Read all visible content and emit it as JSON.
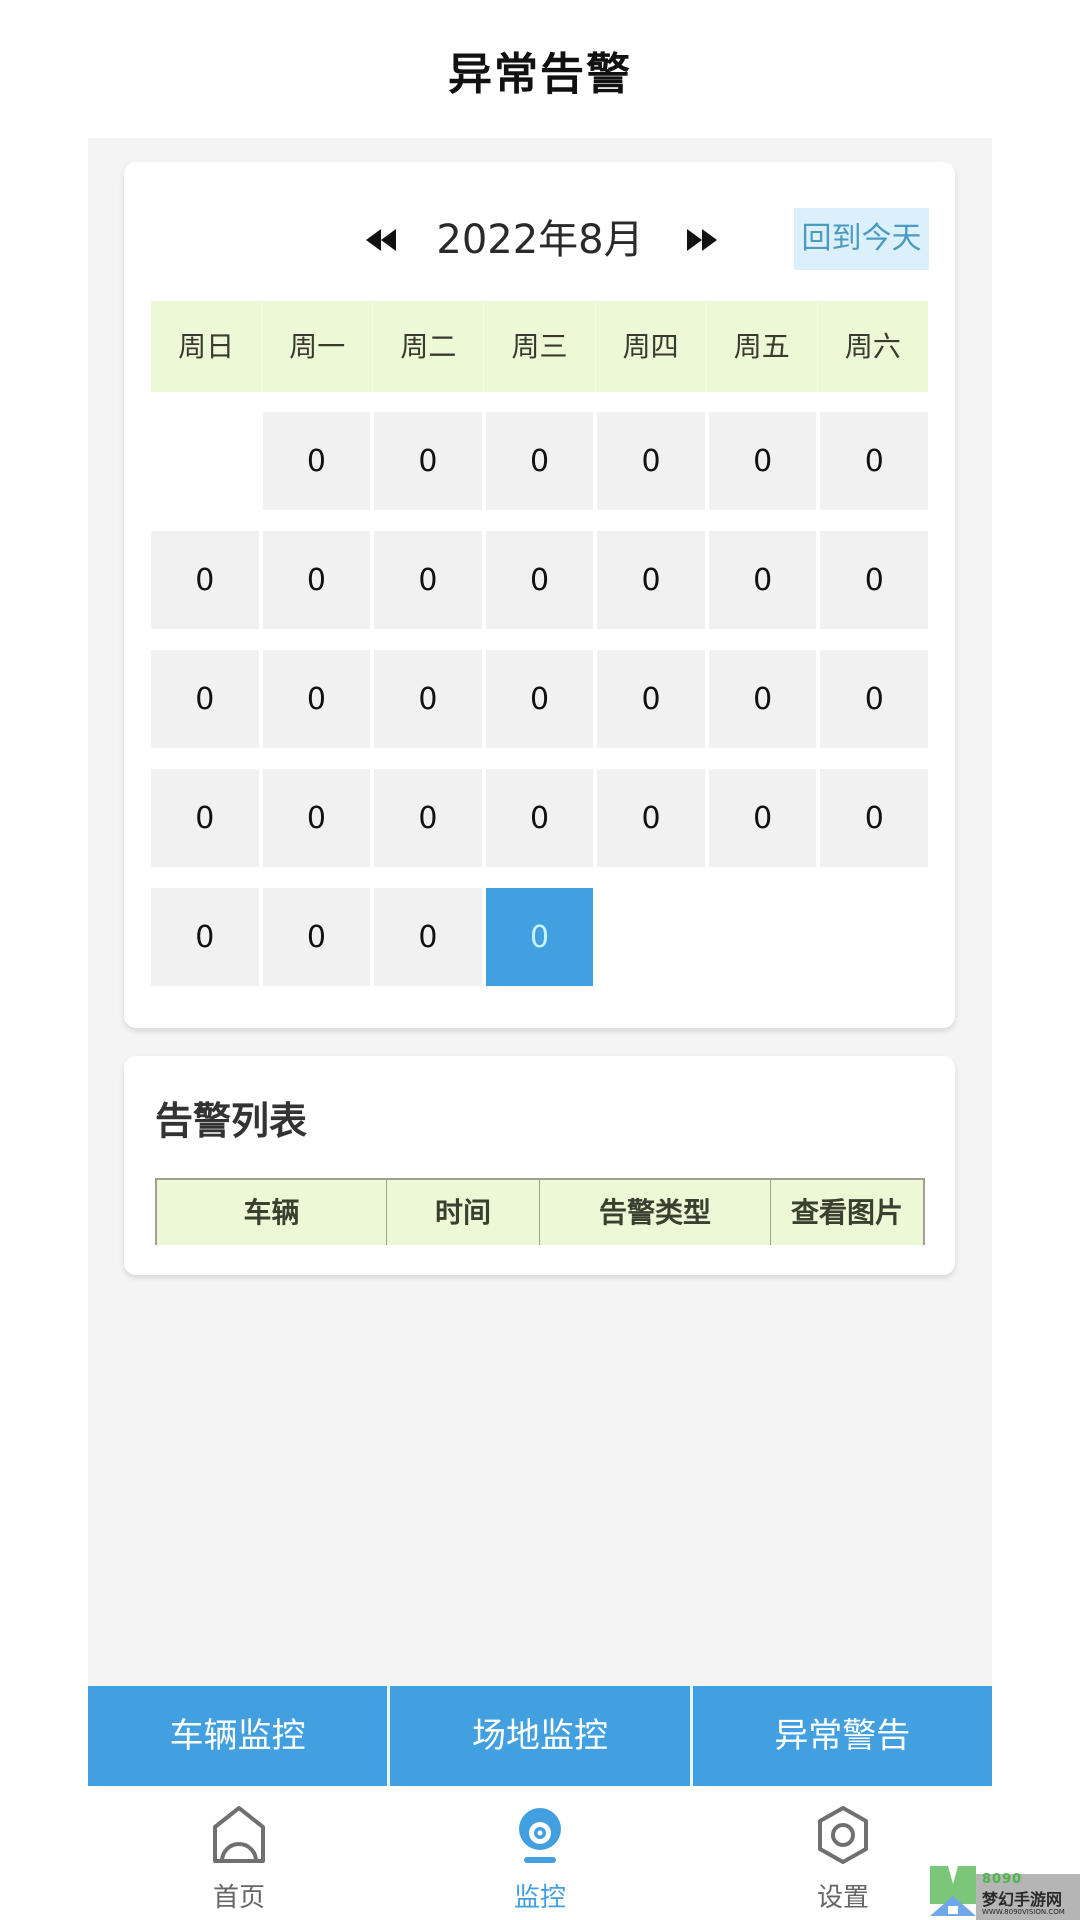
{
  "header": {
    "title": "异常告警"
  },
  "calendar": {
    "month_label": "2022年8月",
    "prev_icon": "double-triangle-left",
    "next_icon": "double-triangle-right",
    "today_button": "回到今天",
    "weekdays": [
      "周日",
      "周一",
      "周二",
      "周三",
      "周四",
      "周五",
      "周六"
    ],
    "weeks": [
      [
        "",
        "0",
        "0",
        "0",
        "0",
        "0",
        "0"
      ],
      [
        "0",
        "0",
        "0",
        "0",
        "0",
        "0",
        "0"
      ],
      [
        "0",
        "0",
        "0",
        "0",
        "0",
        "0",
        "0"
      ],
      [
        "0",
        "0",
        "0",
        "0",
        "0",
        "0",
        "0"
      ],
      [
        "0",
        "0",
        "0",
        "0",
        "",
        "",
        ""
      ]
    ],
    "selected": {
      "week": 4,
      "day": 3
    },
    "colors": {
      "header_bg": "#ecf8d6",
      "cell_bg": "#f1f1f1",
      "selected_bg": "#42a0e0"
    }
  },
  "alert_list": {
    "title": "告警列表",
    "columns": [
      "车辆",
      "时间",
      "告警类型",
      "查看图片"
    ],
    "rows": []
  },
  "sub_tabs": [
    {
      "label": "车辆监控"
    },
    {
      "label": "场地监控"
    },
    {
      "label": "异常警告"
    }
  ],
  "bottom_nav": [
    {
      "label": "首页",
      "icon": "home-icon",
      "active": false
    },
    {
      "label": "监控",
      "icon": "webcam-icon",
      "active": true
    },
    {
      "label": "设置",
      "icon": "settings-icon",
      "active": false
    }
  ],
  "watermark": {
    "number": "8090",
    "name": "梦幻手游网",
    "url": "WWW.8090VISION.COM"
  },
  "colors": {
    "accent": "#42a0e0",
    "page_bg": "#f4f4f4"
  }
}
